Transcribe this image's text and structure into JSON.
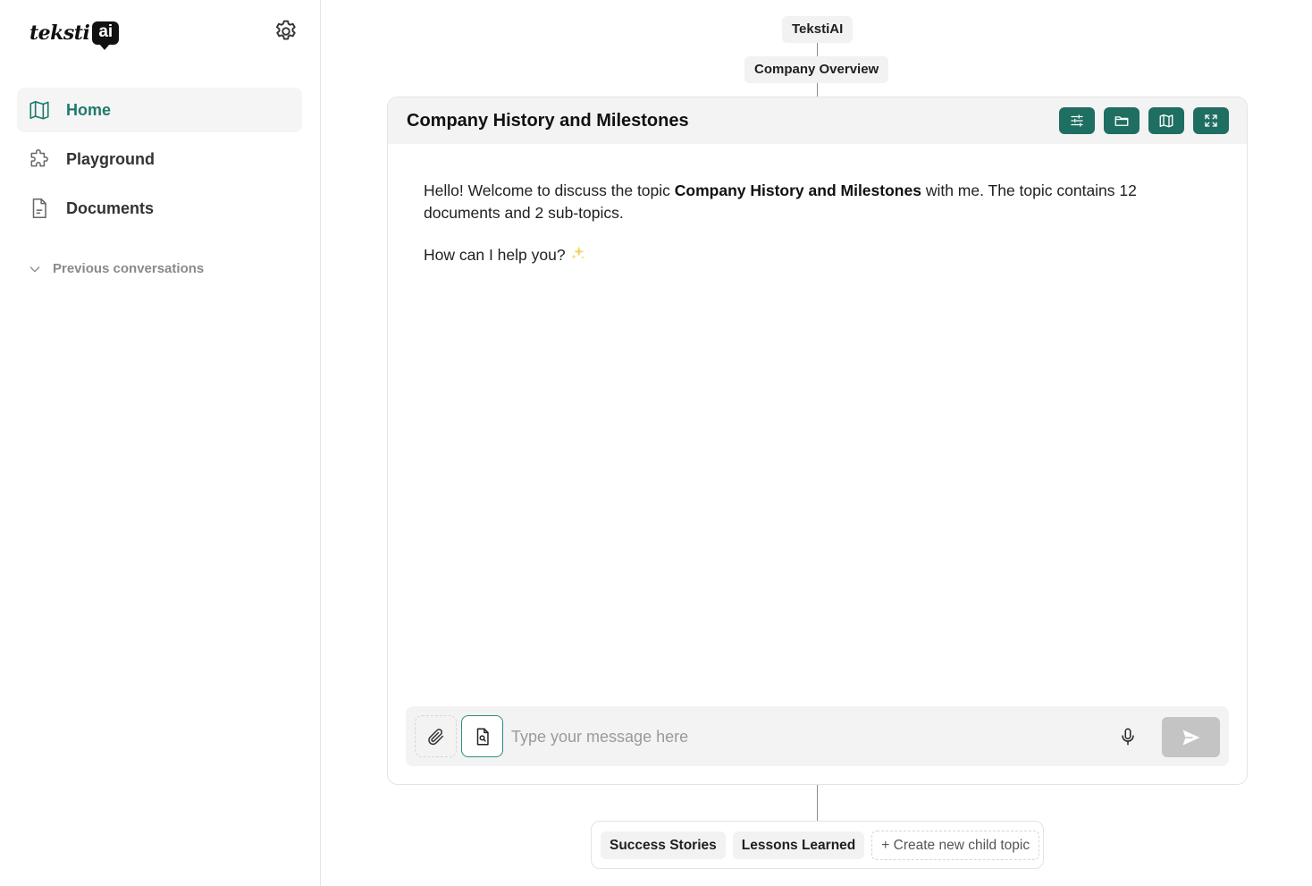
{
  "sidebar": {
    "logo": {
      "text": "teksti",
      "badge": "ai"
    },
    "nav": [
      {
        "label": "Home",
        "icon": "map-icon",
        "active": true
      },
      {
        "label": "Playground",
        "icon": "puzzle-icon",
        "active": false
      },
      {
        "label": "Documents",
        "icon": "document-icon",
        "active": false
      }
    ],
    "previous_conversations_label": "Previous conversations"
  },
  "breadcrumb": {
    "root": "TekstiAI",
    "parent": "Company Overview"
  },
  "topic": {
    "title": "Company History and Milestones",
    "header_buttons": [
      "sliders-icon",
      "folder-icon",
      "map-icon",
      "expand-icon"
    ]
  },
  "message": {
    "line1_prefix": "Hello! Welcome to discuss the topic ",
    "line1_topic": "Company History and Milestones",
    "line1_suffix": " with me. The topic contains 12 documents and 2 sub-topics.",
    "line2": "How can I help you?"
  },
  "input": {
    "placeholder": "Type your message here",
    "value": ""
  },
  "child_topics": {
    "items": [
      "Success Stories",
      "Lessons Learned"
    ],
    "create_label": "+ Create new child topic"
  },
  "colors": {
    "accent": "#1f6e62",
    "accent_text": "#1f7a6b",
    "send_disabled": "#c4c4c4"
  }
}
